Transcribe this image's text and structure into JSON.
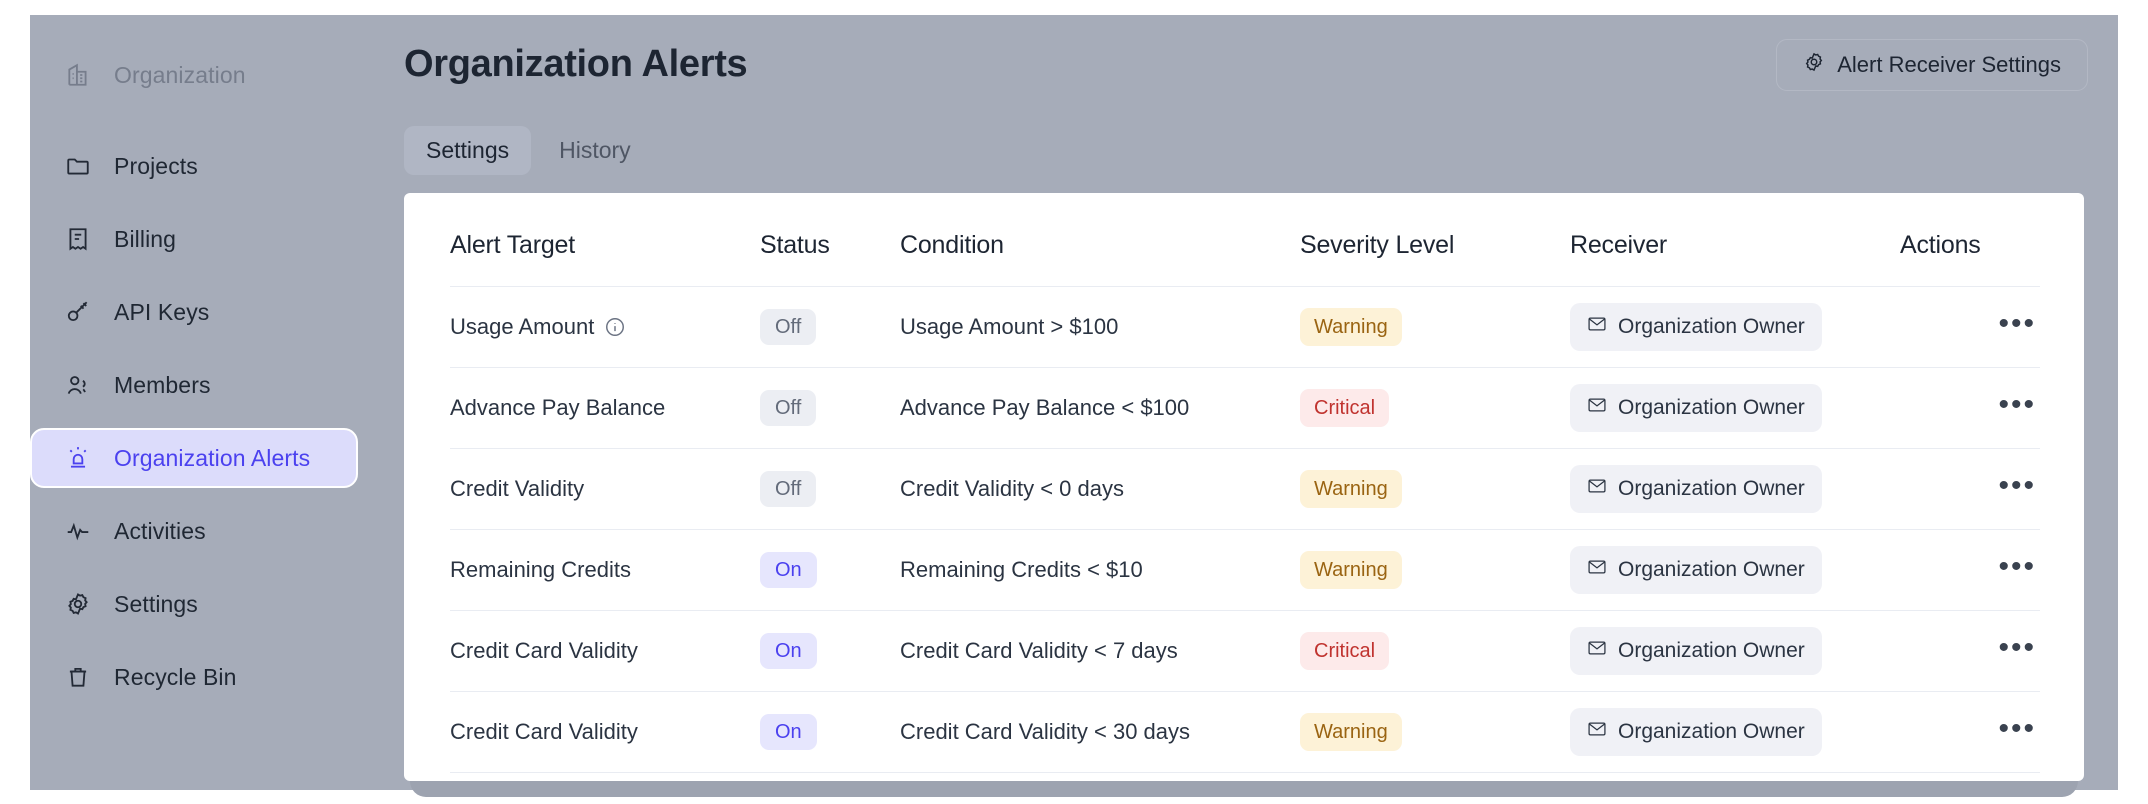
{
  "sidebar": {
    "items": [
      {
        "label": "Organization",
        "icon": "building-icon",
        "state": "muted"
      },
      {
        "label": "Projects",
        "icon": "folder-icon",
        "state": "normal"
      },
      {
        "label": "Billing",
        "icon": "receipt-icon",
        "state": "normal"
      },
      {
        "label": "API Keys",
        "icon": "key-icon",
        "state": "normal"
      },
      {
        "label": "Members",
        "icon": "users-icon",
        "state": "normal"
      },
      {
        "label": "Organization Alerts",
        "icon": "alarm-light-icon",
        "state": "active"
      },
      {
        "label": "Activities",
        "icon": "activity-pulse-icon",
        "state": "normal"
      },
      {
        "label": "Settings",
        "icon": "gear-icon",
        "state": "normal"
      },
      {
        "label": "Recycle Bin",
        "icon": "trash-icon",
        "state": "normal"
      }
    ]
  },
  "header": {
    "title": "Organization Alerts",
    "receiver_settings_label": "Alert Receiver Settings",
    "receiver_settings_icon": "gear-icon"
  },
  "tabs": [
    {
      "label": "Settings",
      "active": true
    },
    {
      "label": "History",
      "active": false
    }
  ],
  "table": {
    "columns": [
      "Alert Target",
      "Status",
      "Condition",
      "Severity Level",
      "Receiver",
      "Actions"
    ],
    "rows": [
      {
        "target": "Usage Amount",
        "has_info_icon": true,
        "status": "Off",
        "condition": "Usage Amount > $100",
        "severity": "Warning",
        "receiver": "Organization Owner",
        "actions": "•••"
      },
      {
        "target": "Advance Pay Balance",
        "has_info_icon": false,
        "status": "Off",
        "condition": "Advance Pay Balance < $100",
        "severity": "Critical",
        "receiver": "Organization Owner",
        "actions": "•••"
      },
      {
        "target": "Credit Validity",
        "has_info_icon": false,
        "status": "Off",
        "condition": "Credit Validity < 0 days",
        "severity": "Warning",
        "receiver": "Organization Owner",
        "actions": "•••"
      },
      {
        "target": "Remaining Credits",
        "has_info_icon": false,
        "status": "On",
        "condition": "Remaining Credits < $10",
        "severity": "Warning",
        "receiver": "Organization Owner",
        "actions": "•••"
      },
      {
        "target": "Credit Card Validity",
        "has_info_icon": false,
        "status": "On",
        "condition": "Credit Card Validity < 7 days",
        "severity": "Critical",
        "receiver": "Organization Owner",
        "actions": "•••"
      },
      {
        "target": "Credit Card Validity",
        "has_info_icon": false,
        "status": "On",
        "condition": "Credit Card Validity < 30 days",
        "severity": "Warning",
        "receiver": "Organization Owner",
        "actions": "•••"
      }
    ]
  },
  "colors": {
    "accent": "#4b41ef",
    "sidebar_bg": "#a6acb9",
    "active_nav_bg": "#dcdcfb",
    "warning_bg": "#fdf2d7",
    "warning_text": "#9a6412",
    "critical_bg": "#fdeaea",
    "critical_text": "#c0332f",
    "status_on_bg": "#e6e6fd",
    "status_off_bg": "#eceef3"
  }
}
